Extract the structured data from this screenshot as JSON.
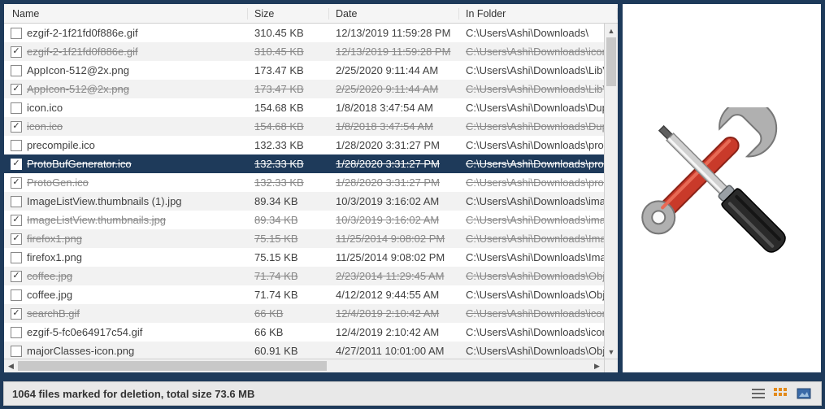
{
  "columns": {
    "name": "Name",
    "size": "Size",
    "date": "Date",
    "folder": "In Folder"
  },
  "rows": [
    {
      "checked": false,
      "marked": false,
      "selected": false,
      "name": "ezgif-2-1f21fd0f886e.gif",
      "size": "310.45 KB",
      "date": "12/13/2019 11:59:28 PM",
      "folder": "C:\\Users\\Ashi\\Downloads\\"
    },
    {
      "checked": true,
      "marked": true,
      "selected": false,
      "name": "ezgif-2-1f21fd0f886e.gif",
      "size": "310.45 KB",
      "date": "12/13/2019 11:59:28 PM",
      "folder": "C:\\Users\\Ashi\\Downloads\\icons"
    },
    {
      "checked": false,
      "marked": false,
      "selected": false,
      "name": "AppIcon-512@2x.png",
      "size": "173.47 KB",
      "date": "2/25/2020 9:11:44 AM",
      "folder": "C:\\Users\\Ashi\\Downloads\\LibV"
    },
    {
      "checked": true,
      "marked": true,
      "selected": false,
      "name": "AppIcon-512@2x.png",
      "size": "173.47 KB",
      "date": "2/25/2020 9:11:44 AM",
      "folder": "C:\\Users\\Ashi\\Downloads\\LibV"
    },
    {
      "checked": false,
      "marked": false,
      "selected": false,
      "name": "icon.ico",
      "size": "154.68 KB",
      "date": "1/8/2018 3:47:54 AM",
      "folder": "C:\\Users\\Ashi\\Downloads\\Dupl"
    },
    {
      "checked": true,
      "marked": true,
      "selected": false,
      "name": "icon.ico",
      "size": "154.68 KB",
      "date": "1/8/2018 3:47:54 AM",
      "folder": "C:\\Users\\Ashi\\Downloads\\Dupl"
    },
    {
      "checked": false,
      "marked": false,
      "selected": false,
      "name": "precompile.ico",
      "size": "132.33 KB",
      "date": "1/28/2020 3:31:27 PM",
      "folder": "C:\\Users\\Ashi\\Downloads\\prot"
    },
    {
      "checked": true,
      "marked": true,
      "selected": true,
      "name": "ProtoBufGenerator.ico",
      "size": "132.33 KB",
      "date": "1/28/2020 3:31:27 PM",
      "folder": "C:\\Users\\Ashi\\Downloads\\prot"
    },
    {
      "checked": true,
      "marked": true,
      "selected": false,
      "name": "ProtoGen.ico",
      "size": "132.33 KB",
      "date": "1/28/2020 3:31:27 PM",
      "folder": "C:\\Users\\Ashi\\Downloads\\prot"
    },
    {
      "checked": false,
      "marked": false,
      "selected": false,
      "name": "ImageListView.thumbnails (1).jpg",
      "size": "89.34 KB",
      "date": "10/3/2019 3:16:02 AM",
      "folder": "C:\\Users\\Ashi\\Downloads\\imag"
    },
    {
      "checked": true,
      "marked": true,
      "selected": false,
      "name": "ImageListView.thumbnails.jpg",
      "size": "89.34 KB",
      "date": "10/3/2019 3:16:02 AM",
      "folder": "C:\\Users\\Ashi\\Downloads\\imag"
    },
    {
      "checked": true,
      "marked": true,
      "selected": false,
      "name": "firefox1.png",
      "size": "75.15 KB",
      "date": "11/25/2014 9:08:02 PM",
      "folder": "C:\\Users\\Ashi\\Downloads\\Imag"
    },
    {
      "checked": false,
      "marked": false,
      "selected": false,
      "name": "firefox1.png",
      "size": "75.15 KB",
      "date": "11/25/2014 9:08:02 PM",
      "folder": "C:\\Users\\Ashi\\Downloads\\Imag"
    },
    {
      "checked": true,
      "marked": true,
      "selected": false,
      "name": "coffee.jpg",
      "size": "71.74 KB",
      "date": "2/23/2014 11:29:45 AM",
      "folder": "C:\\Users\\Ashi\\Downloads\\Obje"
    },
    {
      "checked": false,
      "marked": false,
      "selected": false,
      "name": "coffee.jpg",
      "size": "71.74 KB",
      "date": "4/12/2012 9:44:55 AM",
      "folder": "C:\\Users\\Ashi\\Downloads\\Obje"
    },
    {
      "checked": true,
      "marked": true,
      "selected": false,
      "name": "searchB.gif",
      "size": "66 KB",
      "date": "12/4/2019 2:10:42 AM",
      "folder": "C:\\Users\\Ashi\\Downloads\\icons"
    },
    {
      "checked": false,
      "marked": false,
      "selected": false,
      "name": "ezgif-5-fc0e64917c54.gif",
      "size": "66 KB",
      "date": "12/4/2019 2:10:42 AM",
      "folder": "C:\\Users\\Ashi\\Downloads\\icons"
    },
    {
      "checked": false,
      "marked": false,
      "selected": false,
      "name": "majorClasses-icon.png",
      "size": "60.91 KB",
      "date": "4/27/2011 10:01:00 AM",
      "folder": "C:\\Users\\Ashi\\Downloads\\Obje"
    }
  ],
  "status": "1064 files marked for deletion, total size 73.6 MB"
}
